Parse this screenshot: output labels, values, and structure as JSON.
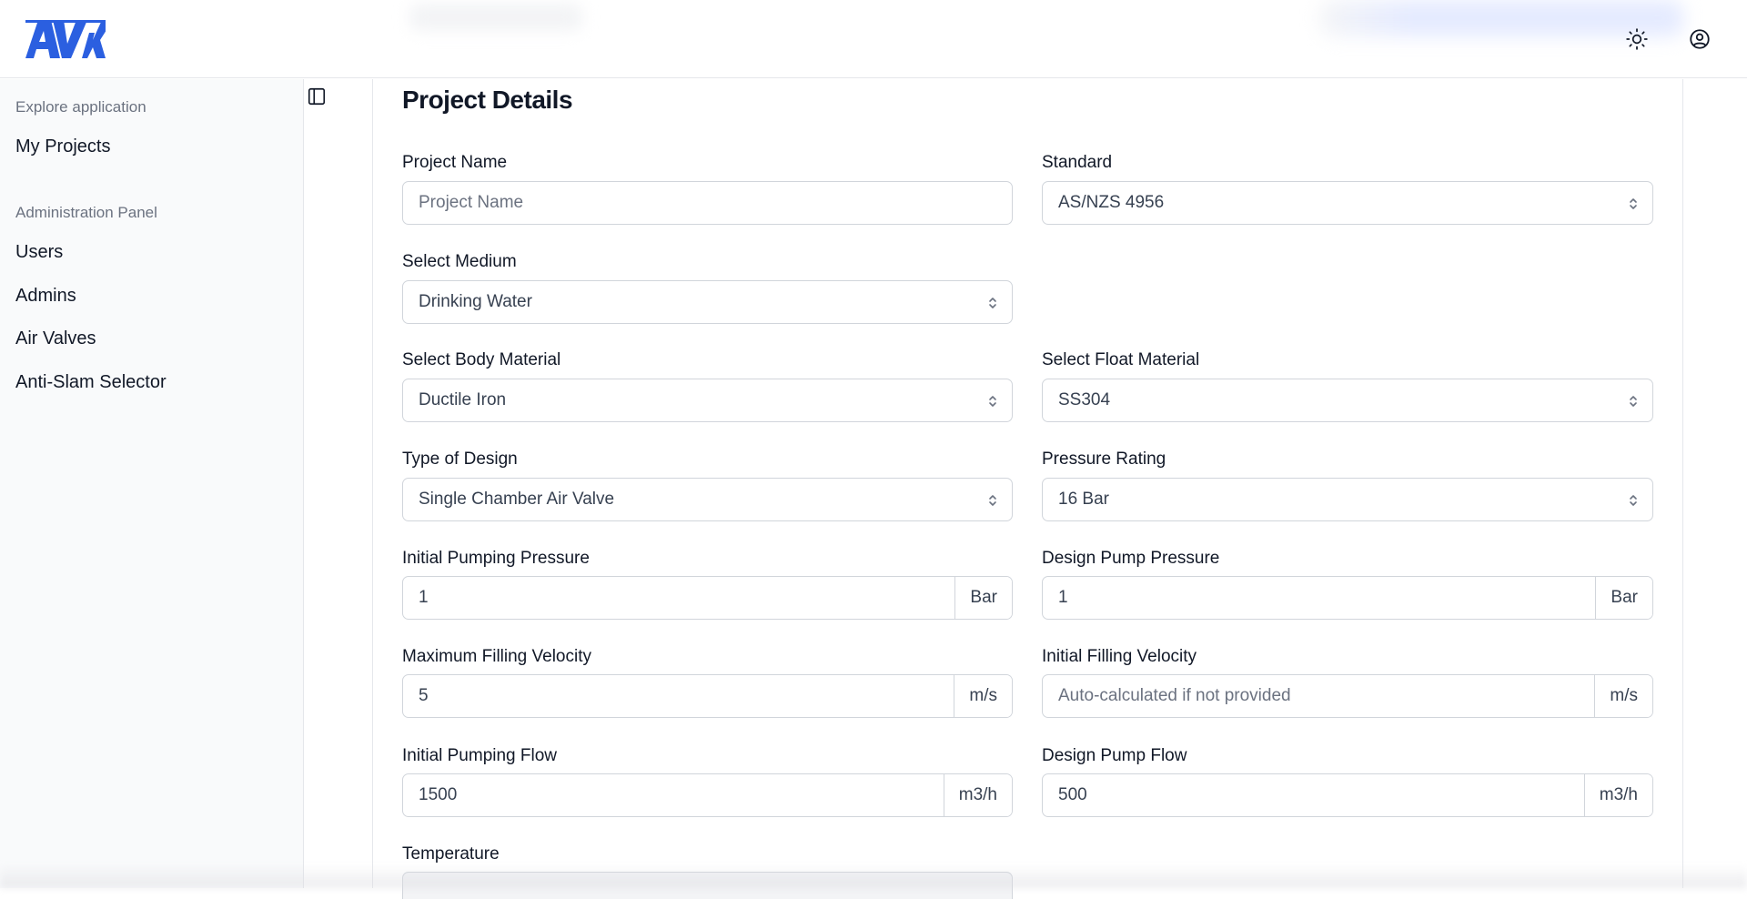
{
  "header": {
    "logo_text": "AVK",
    "brand_color": "#2b5fe0",
    "theme_toggle_icon": "sun-icon",
    "account_icon": "user-circle-icon"
  },
  "sidebar": {
    "groups": [
      {
        "title": "Explore application",
        "items": [
          {
            "label": "My Projects"
          }
        ]
      },
      {
        "title": "Administration Panel",
        "items": [
          {
            "label": "Users"
          },
          {
            "label": "Admins"
          },
          {
            "label": "Air Valves"
          },
          {
            "label": "Anti-Slam Selector"
          }
        ]
      }
    ],
    "collapse_icon": "sidebar-toggle-icon"
  },
  "main": {
    "title": "Project Details",
    "fields": {
      "project_name": {
        "label": "Project Name",
        "placeholder": "Project Name",
        "value": ""
      },
      "standard": {
        "label": "Standard",
        "value": "AS/NZS 4956"
      },
      "medium": {
        "label": "Select Medium",
        "value": "Drinking Water"
      },
      "body_material": {
        "label": "Select Body Material",
        "value": "Ductile Iron"
      },
      "float_material": {
        "label": "Select Float Material",
        "value": "SS304"
      },
      "design_type": {
        "label": "Type of Design",
        "value": "Single Chamber Air Valve"
      },
      "pressure_rating": {
        "label": "Pressure Rating",
        "value": "16 Bar"
      },
      "initial_pumping_pressure": {
        "label": "Initial Pumping Pressure",
        "value": "1",
        "unit": "Bar"
      },
      "design_pump_pressure": {
        "label": "Design Pump Pressure",
        "value": "1",
        "unit": "Bar"
      },
      "max_filling_velocity": {
        "label": "Maximum Filling Velocity",
        "value": "5",
        "unit": "m/s"
      },
      "initial_filling_velocity": {
        "label": "Initial Filling Velocity",
        "placeholder": "Auto-calculated if not provided",
        "unit": "m/s"
      },
      "initial_pumping_flow": {
        "label": "Initial Pumping Flow",
        "value": "1500",
        "unit": "m3/h"
      },
      "design_pump_flow": {
        "label": "Design Pump Flow",
        "value": "500",
        "unit": "m3/h"
      },
      "temperature": {
        "label": "Temperature"
      }
    }
  }
}
